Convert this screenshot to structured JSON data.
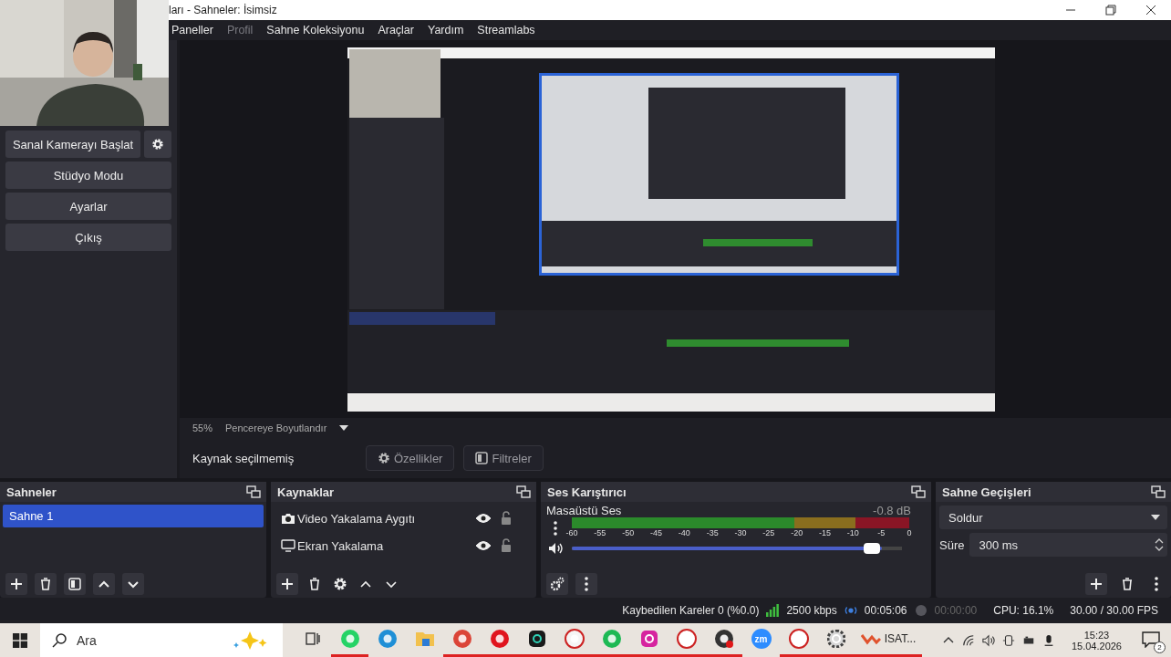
{
  "window": {
    "title": "ları - Sahneler: İsimsiz"
  },
  "menu": [
    {
      "label": "Paneller",
      "disabled": false
    },
    {
      "label": "Profil",
      "disabled": true
    },
    {
      "label": "Sahne Koleksiyonu",
      "disabled": false
    },
    {
      "label": "Araçlar",
      "disabled": false
    },
    {
      "label": "Yardım",
      "disabled": false
    },
    {
      "label": "Streamlabs",
      "disabled": false
    }
  ],
  "controls": [
    {
      "label": "Sanal Kamerayı Başlat",
      "kind": "split"
    },
    {
      "label": "Stüdyo Modu",
      "kind": "plain"
    },
    {
      "label": "Ayarlar",
      "kind": "plain"
    },
    {
      "label": "Çıkış",
      "kind": "plain"
    }
  ],
  "preview": {
    "zoom": "55%",
    "scale_mode": "Pencereye Boyutlandır"
  },
  "source_toolbar": {
    "status": "Kaynak seçilmemiş",
    "buttons": [
      {
        "label": "Özellikler",
        "kind": "properties"
      },
      {
        "label": "Filtreler",
        "kind": "filters"
      }
    ]
  },
  "scenes": {
    "title": "Sahneler",
    "items": [
      {
        "label": "Sahne 1",
        "selected": true
      }
    ]
  },
  "sources": {
    "title": "Kaynaklar",
    "items": [
      {
        "label": "Video Yakalama Aygıtı",
        "kind": "camera",
        "visible": true,
        "locked": false
      },
      {
        "label": "Ekran Yakalama",
        "kind": "display",
        "visible": true,
        "locked": false
      }
    ]
  },
  "mixer": {
    "title": "Ses Karıştırıcı",
    "ticks": [
      "-60",
      "-55",
      "-50",
      "-45",
      "-40",
      "-35",
      "-30",
      "-25",
      "-20",
      "-15",
      "-10",
      "-5",
      "0"
    ],
    "channels": [
      {
        "name": "Masaüstü Ses",
        "reading": "-0.8 dB",
        "level": 0.94
      }
    ]
  },
  "transitions": {
    "title": "Sahne Geçişleri",
    "type": "Soldur",
    "duration_label": "Süre",
    "duration": "300 ms"
  },
  "status_bar": {
    "dropped": "Kaybedilen Kareler 0 (%0.0)",
    "bitrate": "2500 kbps",
    "stream_time": "00:05:06",
    "record_time": "00:00:00",
    "cpu": "CPU: 16.1%",
    "fps": "30.00 / 30.00 FPS"
  },
  "taskbar": {
    "search_placeholder": "Ara",
    "apps": [
      {
        "kind": "taskview",
        "open": false
      },
      {
        "kind": "whatsapp",
        "open": true
      },
      {
        "kind": "edge",
        "open": false
      },
      {
        "kind": "folder",
        "open": false
      },
      {
        "kind": "chrome",
        "open": true
      },
      {
        "kind": "opera",
        "open": true
      },
      {
        "kind": "terminal",
        "open": true
      },
      {
        "kind": "operagx",
        "open": true
      },
      {
        "kind": "spotify",
        "open": true
      },
      {
        "kind": "instagram",
        "open": true
      },
      {
        "kind": "chatgpt",
        "open": true
      },
      {
        "kind": "obs",
        "open": true
      },
      {
        "kind": "zoom",
        "open": false
      },
      {
        "kind": "yandex",
        "open": true
      },
      {
        "kind": "settings",
        "open": true
      }
    ],
    "zoom_label": "zm",
    "pinned_label": "ISAT...",
    "time": "15:23",
    "date": "15.04.2026",
    "notifications": "2"
  }
}
